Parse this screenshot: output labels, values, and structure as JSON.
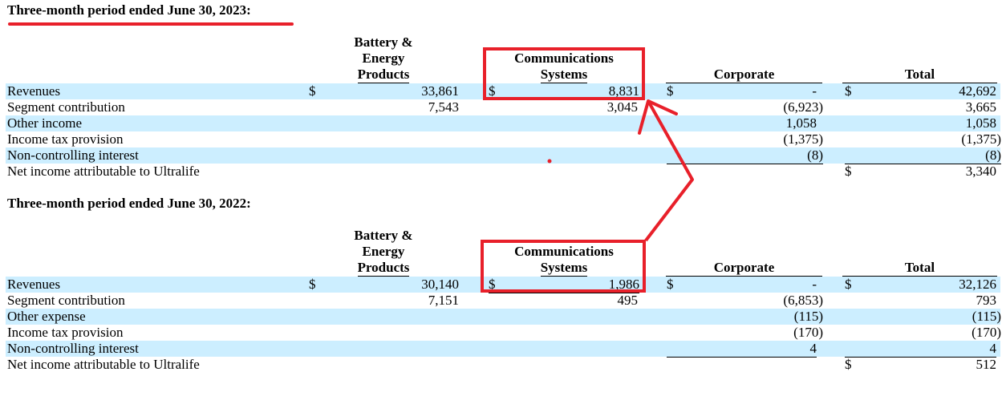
{
  "sections": [
    {
      "title": "Three-month period ended June 30, 2023:",
      "columns": {
        "battery": [
          "Battery &",
          "Energy",
          "Products"
        ],
        "comms": [
          "Communications",
          "Systems"
        ],
        "corporate": "Corporate",
        "total": "Total"
      },
      "rows": [
        {
          "label": "Revenues",
          "battery": "33,861",
          "comms": "8,831",
          "corporate": "-",
          "total": "42,692"
        },
        {
          "label": "Segment contribution",
          "battery": "7,543",
          "comms": "3,045",
          "corporate": "(6,923)",
          "total": "3,665"
        },
        {
          "label": "Other income",
          "battery": "",
          "comms": "",
          "corporate": "1,058",
          "total": "1,058"
        },
        {
          "label": "Income tax provision",
          "battery": "",
          "comms": "",
          "corporate": "(1,375)",
          "total": "(1,375)"
        },
        {
          "label": "Non-controlling interest",
          "battery": "",
          "comms": "",
          "corporate": "(8)",
          "total": "(8)"
        },
        {
          "label": "Net income attributable to Ultralife",
          "battery": "",
          "comms": "",
          "corporate": "",
          "total": "3,340"
        }
      ]
    },
    {
      "title": "Three-month period ended June 30, 2022:",
      "columns": {
        "battery": [
          "Battery &",
          "Energy",
          "Products"
        ],
        "comms": [
          "Communications",
          "Systems"
        ],
        "corporate": "Corporate",
        "total": "Total"
      },
      "rows": [
        {
          "label": "Revenues",
          "battery": "30,140",
          "comms": "1,986",
          "corporate": "-",
          "total": "32,126"
        },
        {
          "label": "Segment contribution",
          "battery": "7,151",
          "comms": "495",
          "corporate": "(6,853)",
          "total": "793"
        },
        {
          "label": "Other expense",
          "battery": "",
          "comms": "",
          "corporate": "(115)",
          "total": "(115)"
        },
        {
          "label": "Income tax provision",
          "battery": "",
          "comms": "",
          "corporate": "(170)",
          "total": "(170)"
        },
        {
          "label": "Non-controlling interest",
          "battery": "",
          "comms": "",
          "corporate": "4",
          "total": "4"
        },
        {
          "label": "Net income attributable to Ultralife",
          "battery": "",
          "comms": "",
          "corporate": "",
          "total": "512"
        }
      ]
    }
  ],
  "currency_symbol": "$",
  "annotation_color": "#e8202a"
}
